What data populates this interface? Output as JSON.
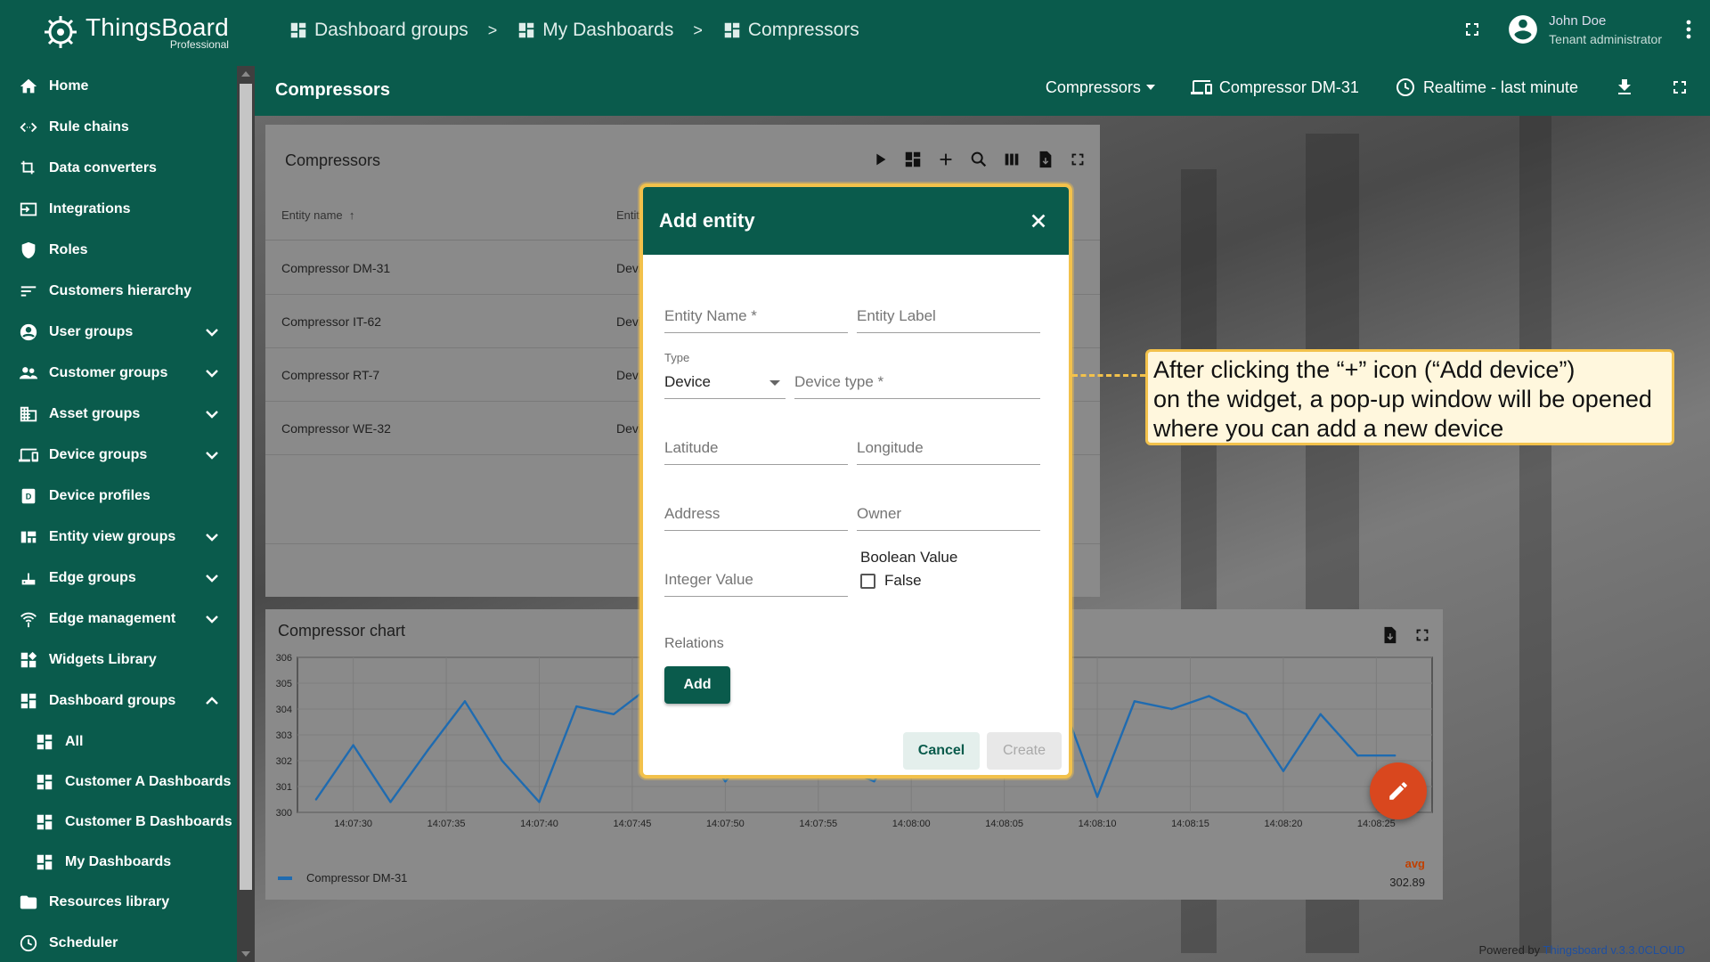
{
  "brand": {
    "name": "ThingsBoard",
    "edition": "Professional"
  },
  "breadcrumb": [
    {
      "label": "Dashboard groups"
    },
    {
      "label": "My Dashboards"
    },
    {
      "label": "Compressors"
    }
  ],
  "breadcrumb_sep": ">",
  "user": {
    "name": "John Doe",
    "role": "Tenant administrator"
  },
  "sidebar": {
    "items": [
      {
        "label": "Home",
        "icon": "home-icon"
      },
      {
        "label": "Rule chains",
        "icon": "code-arrows-icon"
      },
      {
        "label": "Data converters",
        "icon": "transform-icon"
      },
      {
        "label": "Integrations",
        "icon": "input-icon"
      },
      {
        "label": "Roles",
        "icon": "shield-icon"
      },
      {
        "label": "Customers hierarchy",
        "icon": "sort-icon"
      },
      {
        "label": "User groups",
        "icon": "account-circle-icon",
        "expand": true
      },
      {
        "label": "Customer groups",
        "icon": "people-icon",
        "expand": true
      },
      {
        "label": "Asset groups",
        "icon": "domain-icon",
        "expand": true
      },
      {
        "label": "Device groups",
        "icon": "devices-icon",
        "expand": true
      },
      {
        "label": "Device profiles",
        "icon": "device-profile-icon"
      },
      {
        "label": "Entity view groups",
        "icon": "view-quilt-icon",
        "expand": true
      },
      {
        "label": "Edge groups",
        "icon": "router-icon",
        "expand": true
      },
      {
        "label": "Edge management",
        "icon": "settings-input-antenna-icon",
        "expand": true
      },
      {
        "label": "Widgets Library",
        "icon": "widgets-icon"
      },
      {
        "label": "Dashboard groups",
        "icon": "dashboard-icon",
        "expanded": true
      },
      {
        "label": "All",
        "icon": "dashboard-icon",
        "sub": true
      },
      {
        "label": "Customer A Dashboards",
        "icon": "dashboard-icon",
        "sub": true
      },
      {
        "label": "Customer B Dashboards",
        "icon": "dashboard-icon",
        "sub": true
      },
      {
        "label": "My Dashboards",
        "icon": "dashboard-icon",
        "sub": true
      },
      {
        "label": "Resources library",
        "icon": "folder-icon"
      },
      {
        "label": "Scheduler",
        "icon": "schedule-icon"
      }
    ]
  },
  "dashboard": {
    "title": "Compressors",
    "state_select": "Compressors",
    "entity": "Compressor DM-31",
    "timewindow": "Realtime - last minute"
  },
  "entities_widget": {
    "title": "Compressors",
    "col_name": "Entity name",
    "col_type": "Entity",
    "rows": [
      {
        "name": "Compressor DM-31",
        "type": "Devic"
      },
      {
        "name": "Compressor IT-62",
        "type": "Devic"
      },
      {
        "name": "Compressor RT-7",
        "type": "Devic"
      },
      {
        "name": "Compressor WE-32",
        "type": "Devic"
      }
    ]
  },
  "chart_widget": {
    "title": "Compressor chart",
    "legend_avg_label": "avg",
    "legend_avg_value": "302.89"
  },
  "chart_data": {
    "type": "line",
    "ylim": [
      300,
      306
    ],
    "y_ticks": [
      "306",
      "305",
      "304",
      "303",
      "302",
      "301",
      "300"
    ],
    "x_ticks": [
      "14:07:30",
      "14:07:35",
      "14:07:40",
      "14:07:45",
      "14:07:50",
      "14:07:55",
      "14:08:00",
      "14:08:05",
      "14:08:10",
      "14:08:15",
      "14:08:20",
      "14:08:25"
    ],
    "x": [
      "14:07:28",
      "14:07:30",
      "14:07:32",
      "14:07:34",
      "14:07:36",
      "14:07:38",
      "14:07:40",
      "14:07:42",
      "14:07:44",
      "14:07:46",
      "14:07:48",
      "14:07:50",
      "14:07:52",
      "14:07:54",
      "14:07:56",
      "14:07:58",
      "14:08:00",
      "14:08:02",
      "14:08:04",
      "14:08:06",
      "14:08:08",
      "14:08:10",
      "14:08:12",
      "14:08:14",
      "14:08:16",
      "14:08:18",
      "14:08:20",
      "14:08:22",
      "14:08:24",
      "14:08:26"
    ],
    "series": [
      {
        "name": "Compressor DM-31",
        "color": "#1f6bb0",
        "values": [
          300.5,
          302.6,
          300.4,
          302.4,
          304.3,
          302.0,
          300.4,
          304.1,
          303.8,
          304.9,
          303.2,
          301.2,
          302.8,
          302.5,
          301.8,
          301.2,
          303.4,
          304.2,
          303.0,
          301.4,
          304.5,
          300.6,
          304.3,
          304.0,
          304.5,
          303.8,
          301.6,
          303.8,
          302.2,
          302.2
        ]
      }
    ]
  },
  "modal": {
    "title": "Add entity",
    "entity_name_ph": "Entity Name *",
    "entity_label_ph": "Entity Label",
    "type_label": "Type",
    "type_value": "Device",
    "device_type_ph": "Device type *",
    "latitude_ph": "Latitude",
    "longitude_ph": "Longitude",
    "address_ph": "Address",
    "owner_ph": "Owner",
    "integer_ph": "Integer Value",
    "boolean_label": "Boolean Value",
    "boolean_value": "False",
    "relations_label": "Relations",
    "add_btn": "Add",
    "cancel_btn": "Cancel",
    "create_btn": "Create"
  },
  "callout": {
    "line1": "After clicking the “+” icon (“Add device”)",
    "line2": "on the widget, a pop-up window will be opened",
    "line3": "where you can add a new device"
  },
  "footer": {
    "powered": "Powered by",
    "brand": "Thingsboard v.3.3.0CLOUD"
  },
  "colors": {
    "primary": "#0a5b4c",
    "accent": "#d9471e",
    "highlight": "#f2c14b"
  }
}
